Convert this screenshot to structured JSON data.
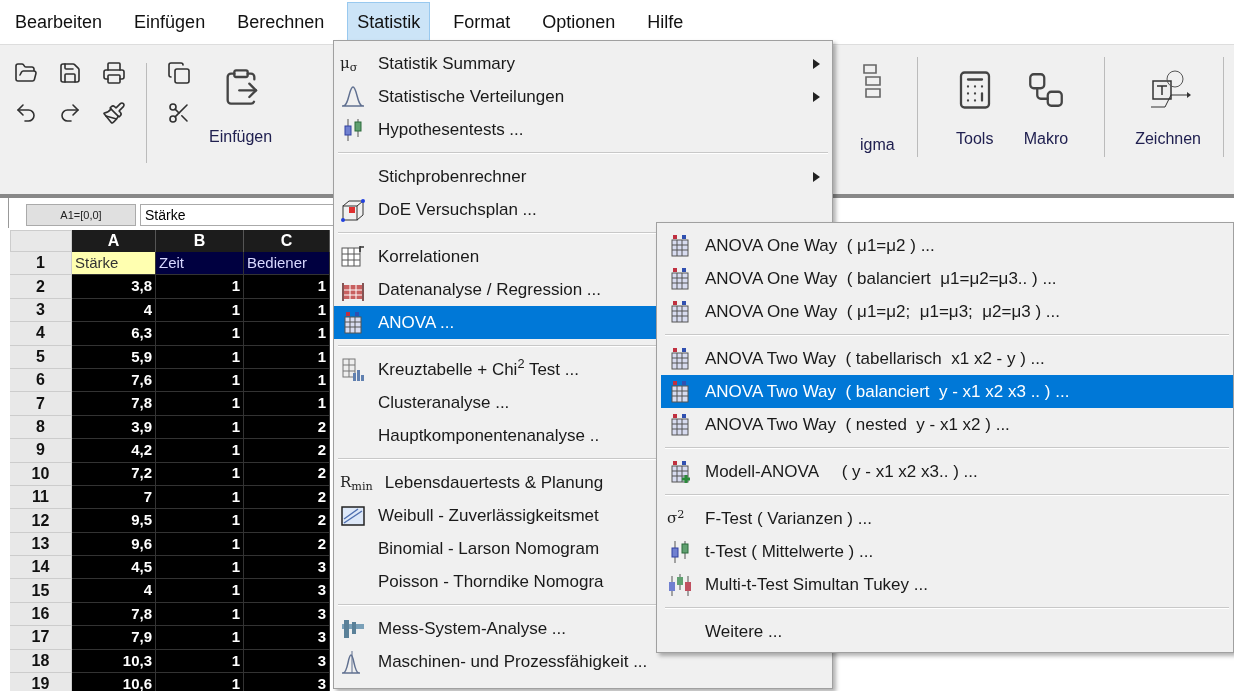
{
  "menu_bar": [
    {
      "label": "Bearbeiten",
      "selected": false
    },
    {
      "label": "Einfügen",
      "selected": false
    },
    {
      "label": "Berechnen",
      "selected": false
    },
    {
      "label": "Statistik",
      "selected": true
    },
    {
      "label": "Format",
      "selected": false
    },
    {
      "label": "Optionen",
      "selected": false
    },
    {
      "label": "Hilfe",
      "selected": false
    }
  ],
  "toolbar": {
    "left_labels": [
      "Einfügen"
    ],
    "right_labels": [
      "igma",
      "Tools",
      "Makro",
      "Zeichnen"
    ]
  },
  "formula_bar": {
    "cell_ref": "A1=[0,0]",
    "value": "Stärke"
  },
  "grid": {
    "columns": [
      "A",
      "B",
      "C"
    ],
    "rows": [
      {
        "number": "1",
        "kind": "label",
        "cells": [
          {
            "text": "Stärke",
            "selected": true
          },
          {
            "text": "Zeit",
            "selected": false
          },
          {
            "text": "Bediener",
            "selected": false
          }
        ]
      },
      {
        "number": "2",
        "kind": "data",
        "cells": [
          {
            "text": "3,8",
            "selected": false
          },
          {
            "text": "1",
            "selected": false
          },
          {
            "text": "1",
            "selected": false
          }
        ]
      },
      {
        "number": "3",
        "kind": "data",
        "cells": [
          {
            "text": "4",
            "selected": false
          },
          {
            "text": "1",
            "selected": false
          },
          {
            "text": "1",
            "selected": false
          }
        ]
      },
      {
        "number": "4",
        "kind": "data",
        "cells": [
          {
            "text": "6,3",
            "selected": false
          },
          {
            "text": "1",
            "selected": false
          },
          {
            "text": "1",
            "selected": false
          }
        ]
      },
      {
        "number": "5",
        "kind": "data",
        "cells": [
          {
            "text": "5,9",
            "selected": false
          },
          {
            "text": "1",
            "selected": false
          },
          {
            "text": "1",
            "selected": false
          }
        ]
      },
      {
        "number": "6",
        "kind": "data",
        "cells": [
          {
            "text": "7,6",
            "selected": false
          },
          {
            "text": "1",
            "selected": false
          },
          {
            "text": "1",
            "selected": false
          }
        ]
      },
      {
        "number": "7",
        "kind": "data",
        "cells": [
          {
            "text": "7,8",
            "selected": false
          },
          {
            "text": "1",
            "selected": false
          },
          {
            "text": "1",
            "selected": false
          }
        ]
      },
      {
        "number": "8",
        "kind": "data",
        "cells": [
          {
            "text": "3,9",
            "selected": false
          },
          {
            "text": "1",
            "selected": false
          },
          {
            "text": "2",
            "selected": false
          }
        ]
      },
      {
        "number": "9",
        "kind": "data",
        "cells": [
          {
            "text": "4,2",
            "selected": false
          },
          {
            "text": "1",
            "selected": false
          },
          {
            "text": "2",
            "selected": false
          }
        ]
      },
      {
        "number": "10",
        "kind": "data",
        "cells": [
          {
            "text": "7,2",
            "selected": false
          },
          {
            "text": "1",
            "selected": false
          },
          {
            "text": "2",
            "selected": false
          }
        ]
      },
      {
        "number": "11",
        "kind": "data",
        "cells": [
          {
            "text": "7",
            "selected": false
          },
          {
            "text": "1",
            "selected": false
          },
          {
            "text": "2",
            "selected": false
          }
        ]
      },
      {
        "number": "12",
        "kind": "data",
        "cells": [
          {
            "text": "9,5",
            "selected": false
          },
          {
            "text": "1",
            "selected": false
          },
          {
            "text": "2",
            "selected": false
          }
        ]
      },
      {
        "number": "13",
        "kind": "data",
        "cells": [
          {
            "text": "9,6",
            "selected": false
          },
          {
            "text": "1",
            "selected": false
          },
          {
            "text": "2",
            "selected": false
          }
        ]
      },
      {
        "number": "14",
        "kind": "data",
        "cells": [
          {
            "text": "4,5",
            "selected": false
          },
          {
            "text": "1",
            "selected": false
          },
          {
            "text": "3",
            "selected": false
          }
        ]
      },
      {
        "number": "15",
        "kind": "data",
        "cells": [
          {
            "text": "4",
            "selected": false
          },
          {
            "text": "1",
            "selected": false
          },
          {
            "text": "3",
            "selected": false
          }
        ]
      },
      {
        "number": "16",
        "kind": "data",
        "cells": [
          {
            "text": "7,8",
            "selected": false
          },
          {
            "text": "1",
            "selected": false
          },
          {
            "text": "3",
            "selected": false
          }
        ]
      },
      {
        "number": "17",
        "kind": "data",
        "cells": [
          {
            "text": "7,9",
            "selected": false
          },
          {
            "text": "1",
            "selected": false
          },
          {
            "text": "3",
            "selected": false
          }
        ]
      },
      {
        "number": "18",
        "kind": "data",
        "cells": [
          {
            "text": "10,3",
            "selected": false
          },
          {
            "text": "1",
            "selected": false
          },
          {
            "text": "3",
            "selected": false
          }
        ]
      },
      {
        "number": "19",
        "kind": "data",
        "cells": [
          {
            "text": "10,6",
            "selected": false
          },
          {
            "text": "1",
            "selected": false
          },
          {
            "text": "3",
            "selected": false
          }
        ]
      }
    ]
  },
  "statistik_menu": {
    "groups": [
      {
        "items": [
          {
            "icon_text": "μ$_{σ}$",
            "label": "Statistik Summary",
            "has_submenu": true,
            "selected": false
          },
          {
            "label": "Statistische Verteilungen",
            "has_submenu": true,
            "selected": false
          },
          {
            "label": "Hypothesentests ...",
            "has_submenu": false,
            "selected": false
          }
        ]
      },
      {
        "items": [
          {
            "label": "Stichprobenrechner",
            "has_submenu": true,
            "selected": false
          },
          {
            "label": "DoE Versuchsplan ...",
            "has_submenu": false,
            "selected": false
          }
        ]
      },
      {
        "items": [
          {
            "label": "Korrelationen",
            "has_submenu": false,
            "selected": false
          },
          {
            "label": "Datenanalyse / Regression ...",
            "has_submenu": false,
            "selected": false
          },
          {
            "label": "ANOVA ...",
            "has_submenu": false,
            "selected": true
          }
        ]
      },
      {
        "items": [
          {
            "label": "Kreuztabelle + Chi$^{2}$ Test ...",
            "has_submenu": false,
            "selected": false
          },
          {
            "label": "Clusteranalyse ...",
            "has_submenu": false,
            "selected": false
          },
          {
            "label": "Hauptkomponentenanalyse ..",
            "has_submenu": false,
            "selected": false
          }
        ]
      },
      {
        "items": [
          {
            "icon_text": "R$_{min}$",
            "label": "Lebensdauertests & Planung",
            "has_submenu": false,
            "selected": false
          },
          {
            "label": "Weibull - Zuverlässigkeitsmet",
            "has_submenu": false,
            "selected": false
          },
          {
            "label": "Binomial - Larson Nomogram",
            "has_submenu": false,
            "selected": false
          },
          {
            "label": "Poisson - Thorndike Nomogra",
            "has_submenu": false,
            "selected": false
          }
        ]
      },
      {
        "items": [
          {
            "label": "Mess-System-Analyse ...",
            "has_submenu": false,
            "selected": false
          },
          {
            "label": "Maschinen- und Prozessfähigkeit ...",
            "has_submenu": false,
            "selected": false
          }
        ]
      }
    ]
  },
  "anova_submenu": {
    "groups": [
      {
        "items": [
          {
            "label": "ANOVA One Way  ( μ1=μ2 ) ...",
            "selected": false
          },
          {
            "label": "ANOVA One Way  ( balanciert  μ1=μ2=μ3.. ) ...",
            "selected": false
          },
          {
            "label": "ANOVA One Way  ( μ1=μ2;  μ1=μ3;  μ2=μ3 ) ...",
            "selected": false
          }
        ]
      },
      {
        "items": [
          {
            "label": "ANOVA Two Way  ( tabellarisch  x1 x2 - y ) ...",
            "selected": false
          },
          {
            "label": "ANOVA Two Way  ( balanciert  y - x1 x2 x3 .. ) ...",
            "selected": true
          },
          {
            "label": "ANOVA Two Way  ( nested  y - x1 x2 ) ...",
            "selected": false
          }
        ]
      },
      {
        "items": [
          {
            "label": "Modell-ANOVA     ( y - x1 x2 x3.. ) ...",
            "selected": false
          }
        ]
      },
      {
        "items": [
          {
            "icon_text": "σ$^{2}$",
            "label": "F-Test ( Varianzen ) ...",
            "selected": false
          },
          {
            "label": "t-Test ( Mittelwerte ) ...",
            "selected": false
          },
          {
            "label": "Multi-t-Test Simultan Tukey ...",
            "selected": false
          }
        ]
      },
      {
        "items": [
          {
            "label": "Weitere ...",
            "selected": false
          }
        ]
      }
    ]
  }
}
